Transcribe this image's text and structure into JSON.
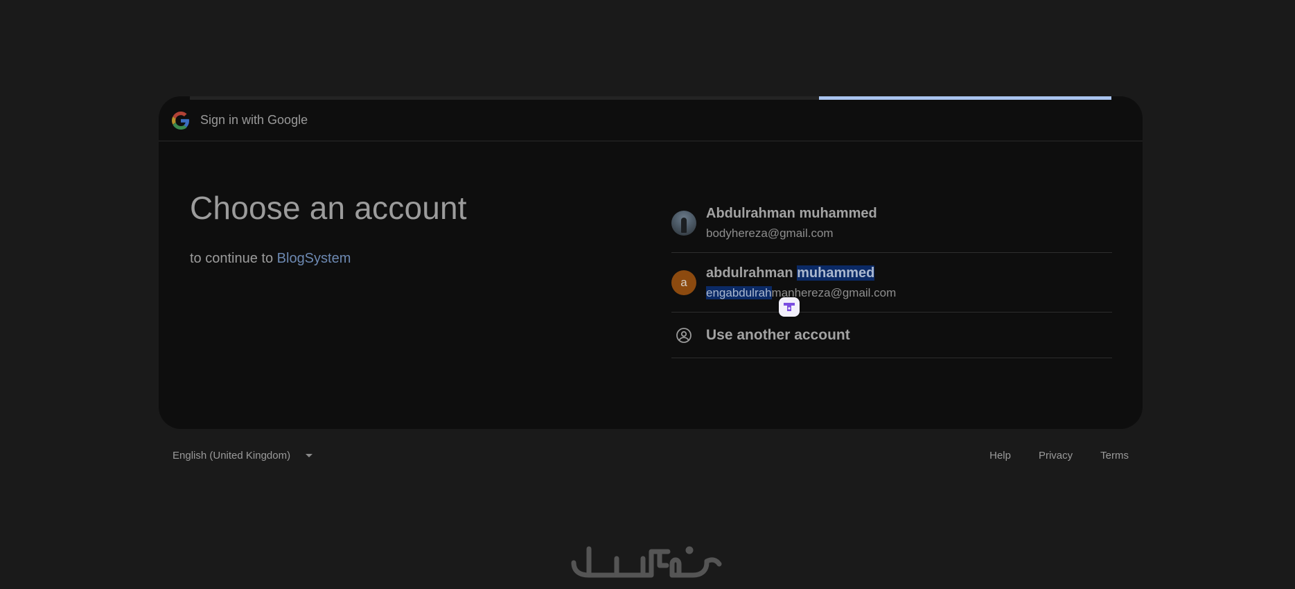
{
  "header": {
    "logo": "google-g-logo",
    "title": "Sign in with Google"
  },
  "progress": {
    "fraction": 0.317
  },
  "main": {
    "heading": "Choose an account",
    "subtitle_prefix": "to continue to",
    "app_name": "BlogSystem"
  },
  "accounts": [
    {
      "name": "Abdulrahman muhammed",
      "email": "bodyhereza@gmail.com",
      "avatar": "photo"
    },
    {
      "name_plain": "abdulrahman ",
      "name_selected": "muhammed",
      "email_selected": "engabdulrah",
      "email_plain": "manhereza@gmail.com",
      "avatar_letter": "a",
      "avatar_color": "#8c4a0f"
    }
  ],
  "use_another": {
    "label": "Use another account",
    "icon": "person-circle-icon"
  },
  "footer": {
    "language": "English (United Kingdom)",
    "links": [
      "Help",
      "Privacy",
      "Terms"
    ]
  },
  "colors": {
    "background": "#1a1a1a",
    "card": "#0e0e0e",
    "accent_link": "#6d89b2",
    "progress": "#a9c4ef",
    "selection": "#0b2a66"
  }
}
